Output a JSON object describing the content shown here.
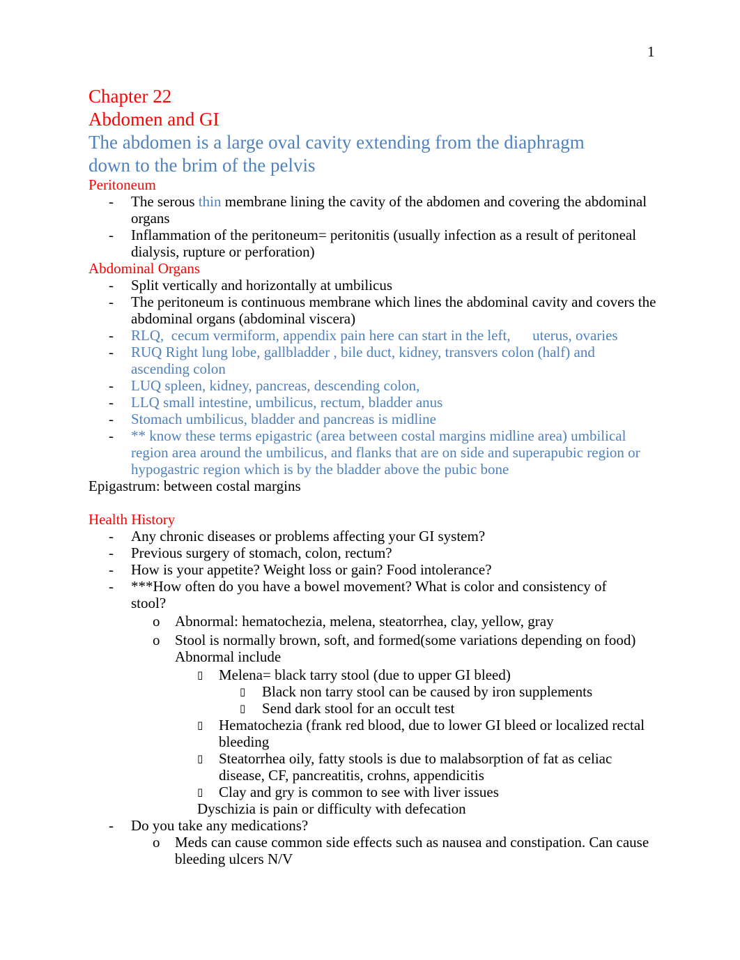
{
  "page_number": "1",
  "title": {
    "chapter": "Chapter 22",
    "subject": "Abdomen and GI",
    "intro": "The abdomen is a large oval cavity extending from the diaphragm down to the brim of the pelvis"
  },
  "markers": {
    "level1": "-",
    "level2": "o",
    "level3": "▯",
    "level4": "▯"
  },
  "peritoneum": {
    "heading": "Peritoneum",
    "items": [
      {
        "pre": "The serous ",
        "highlight": "thin",
        "post": " membrane lining the cavity of the abdomen and covering the abdominal organs"
      },
      {
        "text": "Inflammation of the peritoneum= peritonitis (usually infection as a result of peritoneal dialysis, rupture or perforation)"
      }
    ]
  },
  "organs": {
    "heading": "Abdominal Organs",
    "items": [
      "Split vertically and horizontally at umbilicus",
      "The peritoneum is continuous membrane which lines the abdominal cavity and covers the abdominal organs (abdominal viscera)"
    ],
    "blue_items": [
      "RLQ,  cecum vermiform, appendix pain here can start in the left,      uterus, ovaries",
      "RUQ Right lung lobe, gallbladder  , bile duct, kidney, transvers colon (half) and ascending colon",
      "LUQ spleen, kidney, pancreas, descending colon,",
      "LLQ small intestine, umbilicus, rectum, bladder anus",
      "Stomach umbilicus, bladder and pancreas is midline",
      "** know these terms epigastric (area between costal margins midline area) umbilical region area around the umbilicus, and flanks that are on side and superapubic region or hypogastric region which is by the bladder above the pubic bone"
    ],
    "note": "Epigastrum: between costal margins"
  },
  "history": {
    "heading": "Health History",
    "items": [
      "Any chronic diseases or problems affecting your GI system?",
      "Previous surgery of stomach, colon, rectum?",
      "How is your appetite? Weight loss or gain? Food intolerance?",
      "***How often do you have a bowel movement? What is color and consistency of stool?"
    ],
    "stool": {
      "abnormal": "Abnormal: hematochezia, melena, steatorrhea, clay, yellow, gray",
      "normal": "Stool is normally brown, soft, and formed(some variations depending on food) Abnormal include",
      "melena": "Melena= black tarry stool (due to upper GI bleed)",
      "melena_sub": [
        "Black non tarry stool can be caused by iron supplements",
        "Send dark stool for an occult test"
      ],
      "hematochezia": "Hematochezia (frank red blood, due to lower GI bleed or localized rectal bleeding",
      "steatorrhea": "Steatorrhea oily, fatty stools is due to malabsorption of fat as celiac disease, CF, pancreatitis, crohns, appendicitis",
      "clay": "Clay and gry is common to see with liver issues",
      "dyschizia": "Dyschizia is pain or difficulty with defecation"
    },
    "meds": {
      "question": "Do you take any medications?",
      "note": "Meds can cause common side effects such as nausea and constipation. Can cause bleeding ulcers N/V"
    }
  }
}
